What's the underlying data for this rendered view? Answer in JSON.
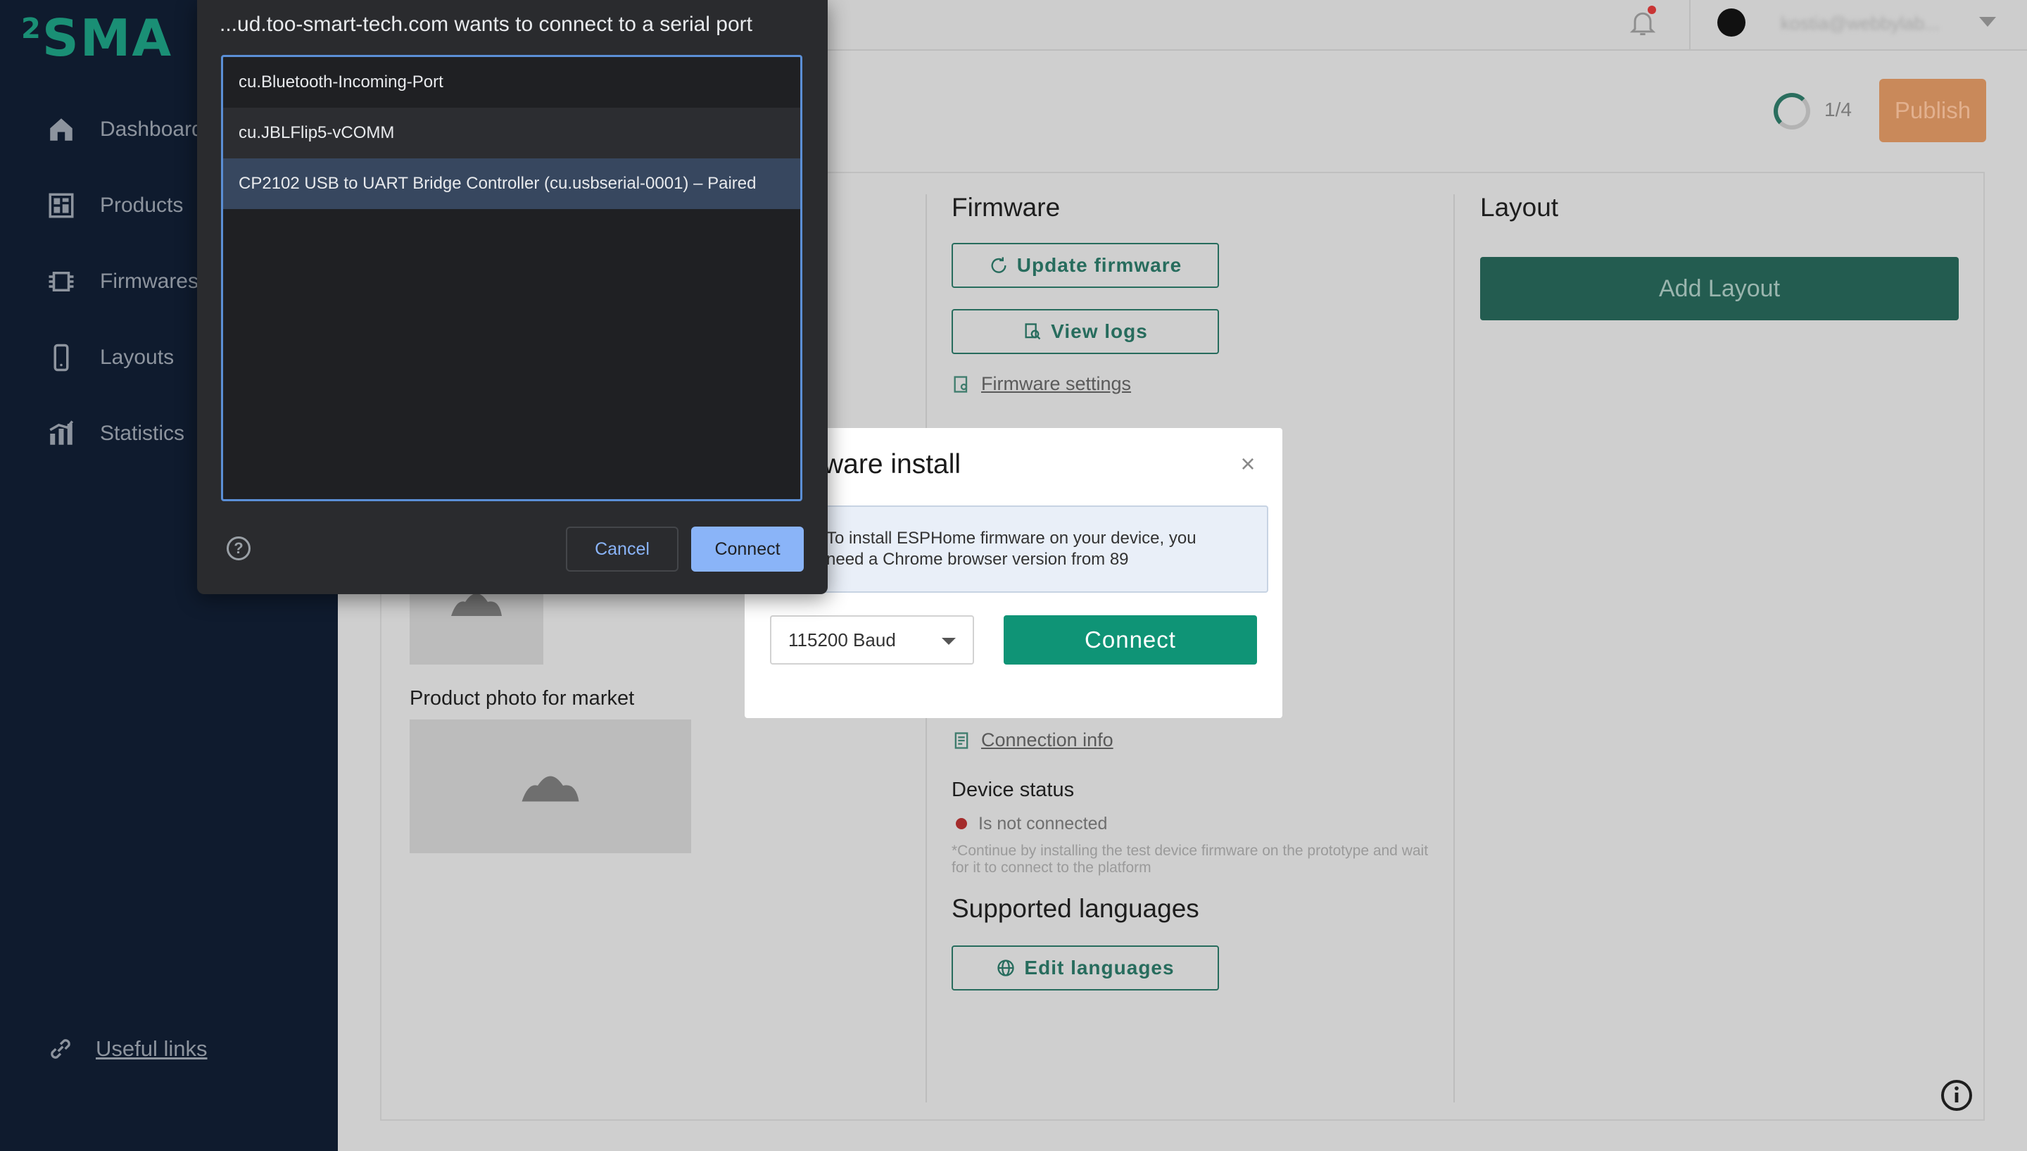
{
  "app": {
    "logo": "SMA",
    "logo_sup": "2"
  },
  "sidebar": {
    "items": [
      {
        "label": "Dashboard",
        "icon": "home-icon"
      },
      {
        "label": "Products",
        "icon": "products-icon"
      },
      {
        "label": "Firmwares",
        "icon": "chip-icon"
      },
      {
        "label": "Layouts",
        "icon": "phone-icon"
      },
      {
        "label": "Statistics",
        "icon": "chart-icon"
      }
    ],
    "useful_links": "Useful links"
  },
  "header": {
    "user_email": "kostia@webbylab...",
    "progress": "1/4",
    "publish_label": "Publish"
  },
  "firmware": {
    "title": "Firmware",
    "update_label": "Update firmware",
    "view_logs_label": "View logs",
    "settings_link": "Firmware settings",
    "connection_info_link": "Connection info",
    "device_status_title": "Device status",
    "device_status_value": "Is not connected",
    "device_status_note": "*Continue by installing the test device firmware on the prototype and wait for it to connect to the platform",
    "languages_title": "Supported languages",
    "edit_languages_label": "Edit languages"
  },
  "layout": {
    "title": "Layout",
    "add_label": "Add Layout"
  },
  "product": {
    "market_photo_label": "Product photo for market"
  },
  "install_modal": {
    "title": "Firmware install",
    "title_visible": "ware install",
    "notice": "To install ESPHome firmware on your device, you need a Chrome browser version from 89",
    "baud_value": "115200 Baud",
    "connect_label": "Connect"
  },
  "serial_chooser": {
    "title": "...ud.too-smart-tech.com wants to connect to a serial port",
    "ports": [
      "cu.Bluetooth-Incoming-Port",
      "cu.JBLFlip5-vCOMM",
      "CP2102 USB to UART Bridge Controller (cu.usbserial-0001) – Paired"
    ],
    "help": "?",
    "cancel_label": "Cancel",
    "connect_label": "Connect"
  },
  "colors": {
    "sidebar_bg": "#0f1b2e",
    "brand_green": "#0f9476",
    "chooser_bg": "#2a2b2e",
    "chooser_accent": "#8ab4f8"
  }
}
